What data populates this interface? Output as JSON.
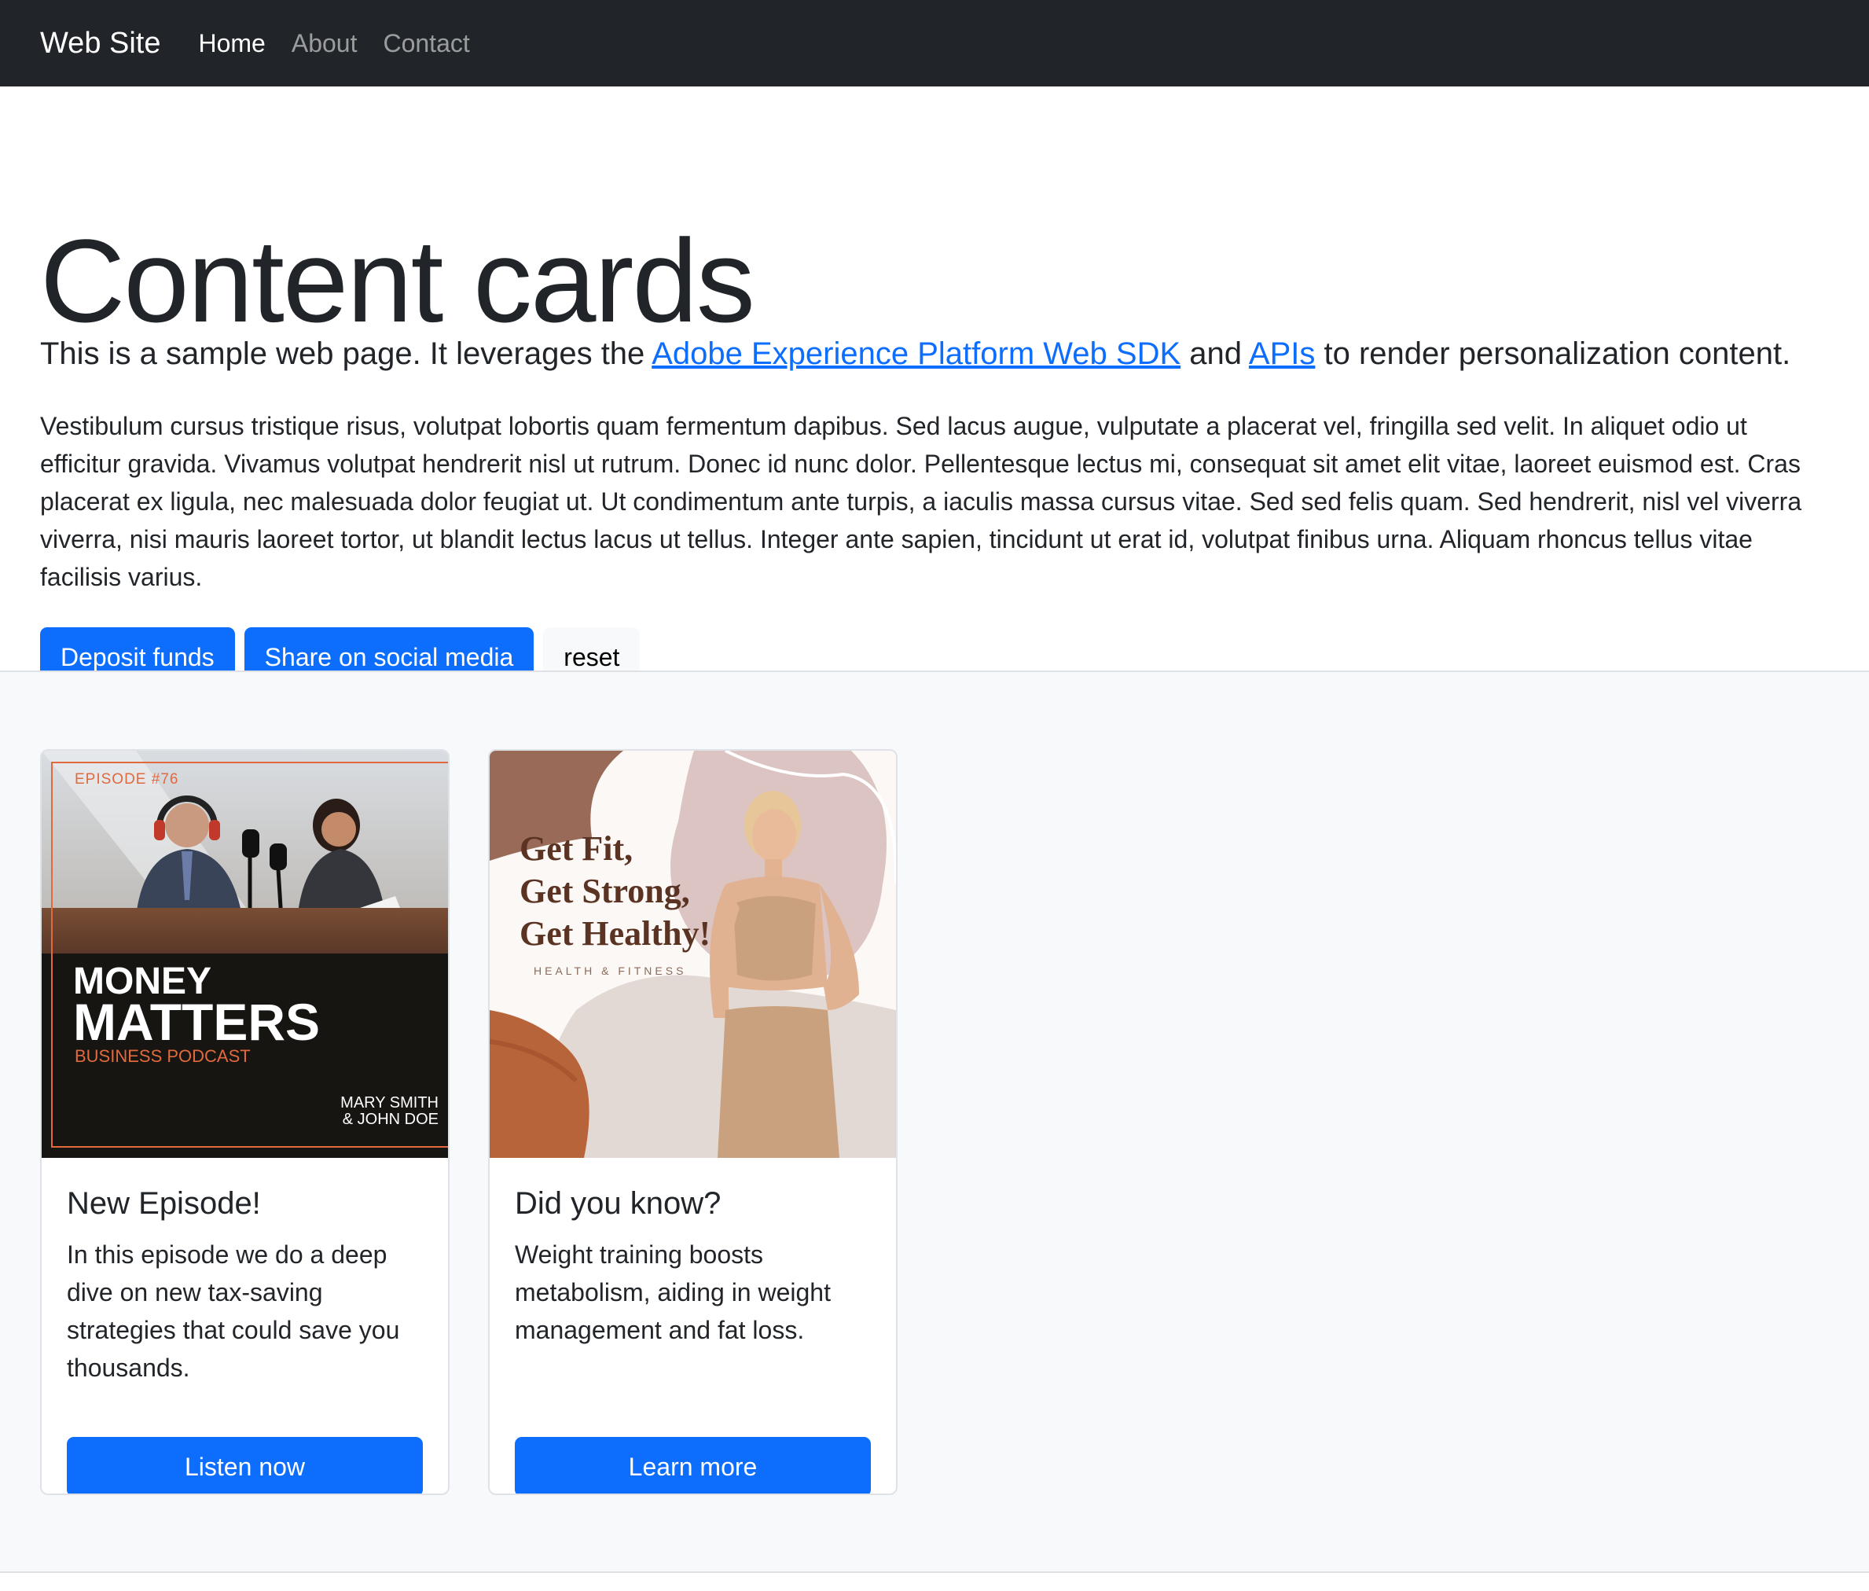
{
  "nav": {
    "brand": "Web Site",
    "links": [
      {
        "label": "Home",
        "active": true
      },
      {
        "label": "About"
      },
      {
        "label": "Contact"
      }
    ]
  },
  "hero": {
    "title": "Content cards",
    "lead_prefix": "This is a sample web page. It leverages the ",
    "lead_link1": "Adobe Experience Platform Web SDK",
    "lead_mid": " and ",
    "lead_link2": "APIs",
    "lead_suffix": " to render personalization content.",
    "paragraph": "Vestibulum cursus tristique risus, volutpat lobortis quam fermentum dapibus. Sed lacus augue, vulputate a placerat vel, fringilla sed velit. In aliquet odio ut efficitur gravida. Vivamus volutpat hendrerit nisl ut rutrum. Donec id nunc dolor. Pellentesque lectus mi, consequat sit amet elit vitae, laoreet euismod est. Cras placerat ex ligula, nec malesuada dolor feugiat ut. Ut condimentum ante turpis, a iaculis massa cursus vitae. Sed sed felis quam. Sed hendrerit, nisl vel viverra viverra, nisi mauris laoreet tortor, ut blandit lectus lacus ut tellus. Integer ante sapien, tincidunt ut erat id, volutpat finibus urna. Aliquam rhoncus tellus vitae facilisis varius.",
    "buttons": {
      "deposit": "Deposit funds",
      "share": "Share on social media",
      "reset": "reset"
    }
  },
  "cards": [
    {
      "image": {
        "episode": "EPISODE #76",
        "line1": "MONEY",
        "line2": "MATTERS",
        "line3": "BUSINESS PODCAST",
        "hosts1": "MARY SMITH",
        "hosts2": "& JOHN DOE"
      },
      "title": "New Episode!",
      "text": "In this episode we do a deep dive on new tax-saving strategies that could save you thousands.",
      "button": "Listen now"
    },
    {
      "image": {
        "line1": "Get Fit,",
        "line2": "Get Strong,",
        "line3": "Get Healthy!",
        "sub": "HEALTH & FITNESS"
      },
      "title": "Did you know?",
      "text": "Weight training boosts metabolism, aiding in weight management and fat loss.",
      "button": "Learn more"
    }
  ],
  "colors": {
    "navbar": "#212529",
    "primary": "#0d6efd",
    "band": "#f8f9fa",
    "podcast_accent": "#e06a3e"
  }
}
